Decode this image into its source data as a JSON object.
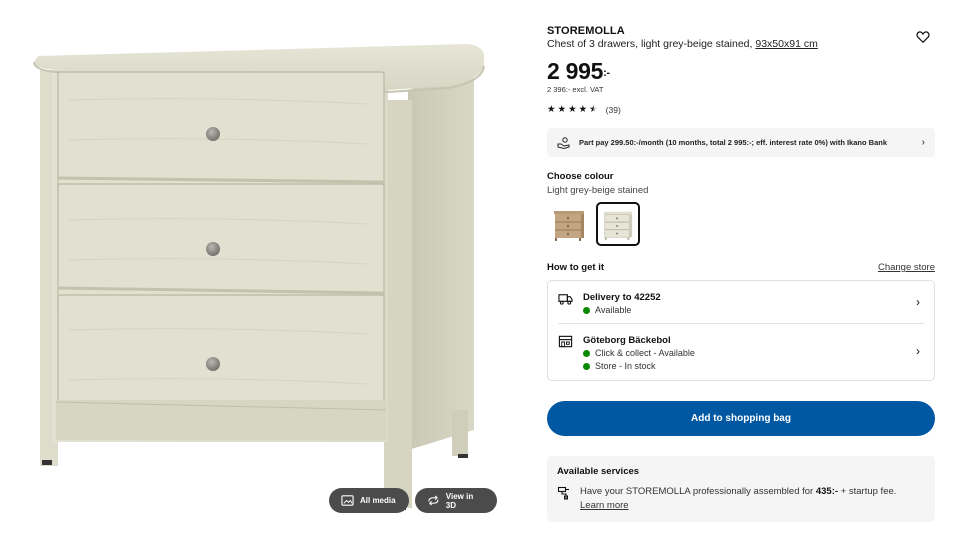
{
  "gallery": {
    "all_media_label": "All media",
    "view_3d_label": "View in 3D"
  },
  "product": {
    "name": "STOREMOLLA",
    "description": "Chest of 3 drawers, light grey-beige stained,",
    "dimensions": "93x50x91 cm",
    "price_main": "2 995",
    "price_suffix": ":-",
    "price_excl_vat": "2 396:- excl. VAT",
    "rating_stars": 4.5,
    "rating_count": "(39)"
  },
  "partpay": {
    "text": "Part pay 299.50:-/month (10 months, total 2 995:-; eff. interest rate 0%) with Ikano Bank"
  },
  "colour": {
    "heading": "Choose colour",
    "selected": "Light grey-beige stained",
    "swatches": [
      "brown-stained-dresser",
      "light-grey-beige-dresser"
    ]
  },
  "fulfilment": {
    "heading": "How to get it",
    "change_store": "Change store",
    "delivery": {
      "label": "Delivery to 42252",
      "status": "Available"
    },
    "store": {
      "label": "Göteborg Bäckebol",
      "status_1": "Click & collect - Available",
      "status_2": "Store - In stock"
    }
  },
  "cta": {
    "add_to_bag": "Add to shopping bag"
  },
  "services": {
    "heading": "Available services",
    "text_before": "Have your STOREMOLLA professionally assembled for ",
    "price": "435:-",
    "text_after": " + startup fee. ",
    "link": "Learn more"
  },
  "colors": {
    "primary_blue": "#0058a3",
    "status_green": "#0a8a00",
    "panel_grey": "#f5f5f5"
  }
}
